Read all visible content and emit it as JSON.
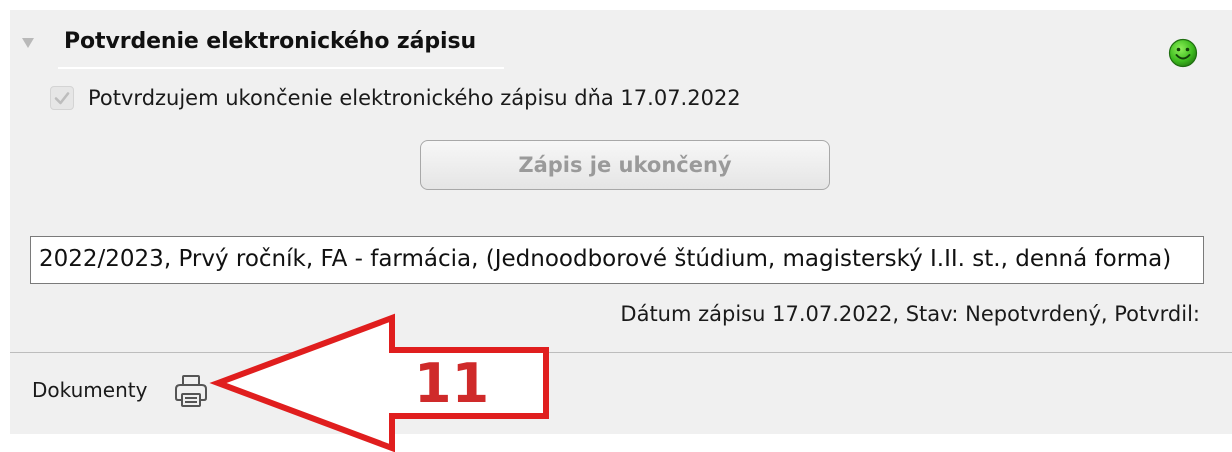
{
  "section": {
    "title": "Potvrdenie elektronického zápisu",
    "status_icon": "green-smiley-icon"
  },
  "confirmation": {
    "checkbox_checked": true,
    "label": "Potvrdzujem ukončenie elektronického zápisu dňa 17.07.2022"
  },
  "status_button": {
    "label": "Zápis je ukončený",
    "disabled": true
  },
  "study": {
    "value": "2022/2023, Prvý ročník, FA - farmácia, (Jednoodborové štúdium, magisterský I.II. st., denná forma)",
    "enrollment_info": "Dátum zápisu 17.07.2022, Stav: Nepotvrdený, Potvrdil:"
  },
  "documents": {
    "label": "Dokumenty",
    "icon": "printer-icon"
  },
  "annotation": {
    "number": "11",
    "color": "#e01e1e"
  }
}
